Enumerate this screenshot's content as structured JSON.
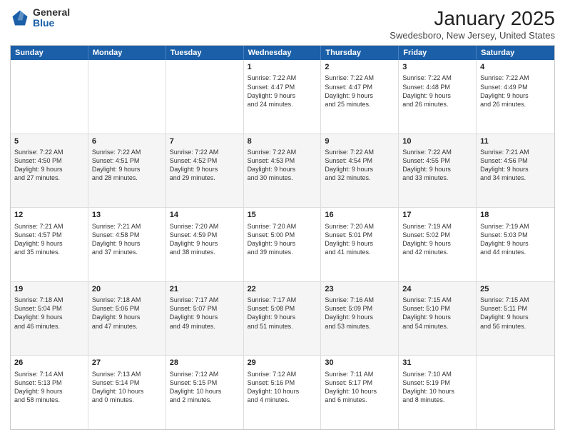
{
  "logo": {
    "general": "General",
    "blue": "Blue"
  },
  "title": "January 2025",
  "location": "Swedesboro, New Jersey, United States",
  "weekdays": [
    "Sunday",
    "Monday",
    "Tuesday",
    "Wednesday",
    "Thursday",
    "Friday",
    "Saturday"
  ],
  "rows": [
    [
      {
        "day": "",
        "info": ""
      },
      {
        "day": "",
        "info": ""
      },
      {
        "day": "",
        "info": ""
      },
      {
        "day": "1",
        "info": "Sunrise: 7:22 AM\nSunset: 4:47 PM\nDaylight: 9 hours\nand 24 minutes."
      },
      {
        "day": "2",
        "info": "Sunrise: 7:22 AM\nSunset: 4:47 PM\nDaylight: 9 hours\nand 25 minutes."
      },
      {
        "day": "3",
        "info": "Sunrise: 7:22 AM\nSunset: 4:48 PM\nDaylight: 9 hours\nand 26 minutes."
      },
      {
        "day": "4",
        "info": "Sunrise: 7:22 AM\nSunset: 4:49 PM\nDaylight: 9 hours\nand 26 minutes."
      }
    ],
    [
      {
        "day": "5",
        "info": "Sunrise: 7:22 AM\nSunset: 4:50 PM\nDaylight: 9 hours\nand 27 minutes."
      },
      {
        "day": "6",
        "info": "Sunrise: 7:22 AM\nSunset: 4:51 PM\nDaylight: 9 hours\nand 28 minutes."
      },
      {
        "day": "7",
        "info": "Sunrise: 7:22 AM\nSunset: 4:52 PM\nDaylight: 9 hours\nand 29 minutes."
      },
      {
        "day": "8",
        "info": "Sunrise: 7:22 AM\nSunset: 4:53 PM\nDaylight: 9 hours\nand 30 minutes."
      },
      {
        "day": "9",
        "info": "Sunrise: 7:22 AM\nSunset: 4:54 PM\nDaylight: 9 hours\nand 32 minutes."
      },
      {
        "day": "10",
        "info": "Sunrise: 7:22 AM\nSunset: 4:55 PM\nDaylight: 9 hours\nand 33 minutes."
      },
      {
        "day": "11",
        "info": "Sunrise: 7:21 AM\nSunset: 4:56 PM\nDaylight: 9 hours\nand 34 minutes."
      }
    ],
    [
      {
        "day": "12",
        "info": "Sunrise: 7:21 AM\nSunset: 4:57 PM\nDaylight: 9 hours\nand 35 minutes."
      },
      {
        "day": "13",
        "info": "Sunrise: 7:21 AM\nSunset: 4:58 PM\nDaylight: 9 hours\nand 37 minutes."
      },
      {
        "day": "14",
        "info": "Sunrise: 7:20 AM\nSunset: 4:59 PM\nDaylight: 9 hours\nand 38 minutes."
      },
      {
        "day": "15",
        "info": "Sunrise: 7:20 AM\nSunset: 5:00 PM\nDaylight: 9 hours\nand 39 minutes."
      },
      {
        "day": "16",
        "info": "Sunrise: 7:20 AM\nSunset: 5:01 PM\nDaylight: 9 hours\nand 41 minutes."
      },
      {
        "day": "17",
        "info": "Sunrise: 7:19 AM\nSunset: 5:02 PM\nDaylight: 9 hours\nand 42 minutes."
      },
      {
        "day": "18",
        "info": "Sunrise: 7:19 AM\nSunset: 5:03 PM\nDaylight: 9 hours\nand 44 minutes."
      }
    ],
    [
      {
        "day": "19",
        "info": "Sunrise: 7:18 AM\nSunset: 5:04 PM\nDaylight: 9 hours\nand 46 minutes."
      },
      {
        "day": "20",
        "info": "Sunrise: 7:18 AM\nSunset: 5:06 PM\nDaylight: 9 hours\nand 47 minutes."
      },
      {
        "day": "21",
        "info": "Sunrise: 7:17 AM\nSunset: 5:07 PM\nDaylight: 9 hours\nand 49 minutes."
      },
      {
        "day": "22",
        "info": "Sunrise: 7:17 AM\nSunset: 5:08 PM\nDaylight: 9 hours\nand 51 minutes."
      },
      {
        "day": "23",
        "info": "Sunrise: 7:16 AM\nSunset: 5:09 PM\nDaylight: 9 hours\nand 53 minutes."
      },
      {
        "day": "24",
        "info": "Sunrise: 7:15 AM\nSunset: 5:10 PM\nDaylight: 9 hours\nand 54 minutes."
      },
      {
        "day": "25",
        "info": "Sunrise: 7:15 AM\nSunset: 5:11 PM\nDaylight: 9 hours\nand 56 minutes."
      }
    ],
    [
      {
        "day": "26",
        "info": "Sunrise: 7:14 AM\nSunset: 5:13 PM\nDaylight: 9 hours\nand 58 minutes."
      },
      {
        "day": "27",
        "info": "Sunrise: 7:13 AM\nSunset: 5:14 PM\nDaylight: 10 hours\nand 0 minutes."
      },
      {
        "day": "28",
        "info": "Sunrise: 7:12 AM\nSunset: 5:15 PM\nDaylight: 10 hours\nand 2 minutes."
      },
      {
        "day": "29",
        "info": "Sunrise: 7:12 AM\nSunset: 5:16 PM\nDaylight: 10 hours\nand 4 minutes."
      },
      {
        "day": "30",
        "info": "Sunrise: 7:11 AM\nSunset: 5:17 PM\nDaylight: 10 hours\nand 6 minutes."
      },
      {
        "day": "31",
        "info": "Sunrise: 7:10 AM\nSunset: 5:19 PM\nDaylight: 10 hours\nand 8 minutes."
      },
      {
        "day": "",
        "info": ""
      }
    ]
  ]
}
